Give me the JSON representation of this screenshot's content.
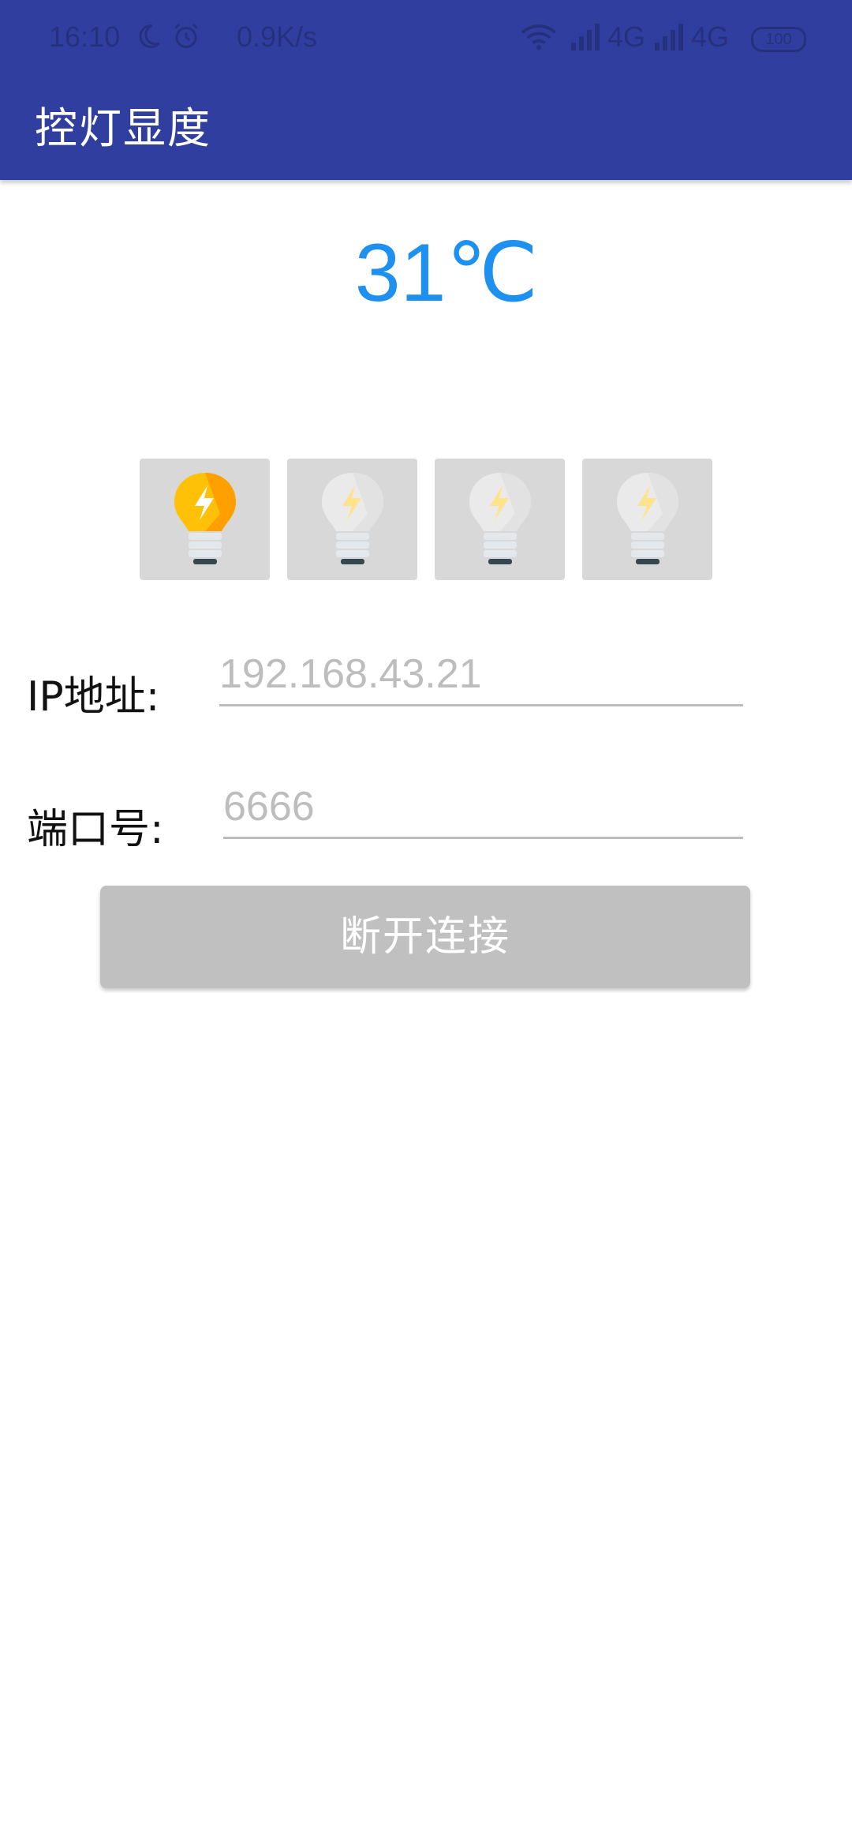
{
  "status_bar": {
    "time": "16:10",
    "net_speed": "0.9K/s",
    "network_1": "4G",
    "network_2": "4G",
    "battery": "100",
    "icons": [
      "moon-icon",
      "alarm-icon",
      "wifi-icon",
      "signal-icon",
      "signal-icon",
      "battery-icon"
    ]
  },
  "app_bar": {
    "title": "控灯显度",
    "color": "#303f9f"
  },
  "temperature": {
    "value": "31℃",
    "color": "#1e90ef"
  },
  "bulbs": [
    {
      "name": "bulb-1",
      "state": "on",
      "icon": "lightbulb-icon"
    },
    {
      "name": "bulb-2",
      "state": "off",
      "icon": "lightbulb-icon"
    },
    {
      "name": "bulb-3",
      "state": "off",
      "icon": "lightbulb-icon"
    },
    {
      "name": "bulb-4",
      "state": "off",
      "icon": "lightbulb-icon"
    }
  ],
  "form": {
    "ip_label": "IP地址:",
    "ip_placeholder": "192.168.43.21",
    "port_label": "端口号:",
    "port_placeholder": "6666"
  },
  "actions": {
    "disconnect_label": "断开连接"
  }
}
